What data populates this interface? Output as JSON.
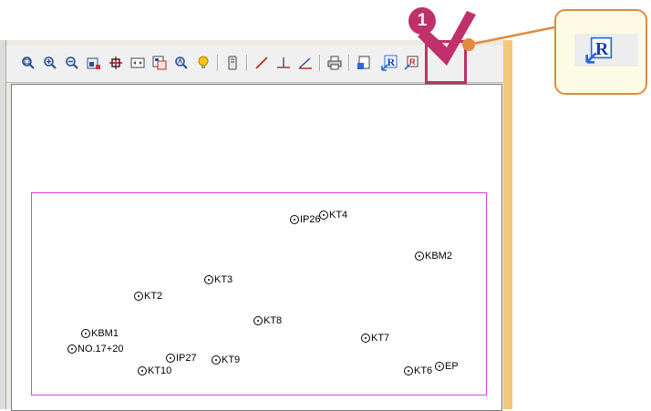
{
  "toolbar": {
    "buttons": [
      {
        "name": "zoom-window-icon"
      },
      {
        "name": "zoom-in-icon"
      },
      {
        "name": "zoom-out-icon"
      },
      {
        "name": "zoom-all-icon"
      },
      {
        "name": "pan-icon"
      },
      {
        "name": "fit-extents-icon"
      },
      {
        "name": "zoom-previous-icon"
      },
      {
        "name": "zoom-realtime-icon"
      },
      {
        "name": "bulb-icon"
      },
      {
        "name": "layer-icon"
      },
      {
        "name": "draw-line-icon"
      },
      {
        "name": "draw-perpendicular-icon"
      },
      {
        "name": "draw-angle-icon"
      },
      {
        "name": "print-icon"
      },
      {
        "name": "export-icon"
      },
      {
        "name": "register-r-icon"
      },
      {
        "name": "register-mark-icon"
      }
    ]
  },
  "annotation": {
    "step_number": "1",
    "accent_color": "#c0306a",
    "callout_border_color": "#e28a3e"
  },
  "points": [
    {
      "label": "IP26"
    },
    {
      "label": "KT4"
    },
    {
      "label": "KBM2"
    },
    {
      "label": "KT3"
    },
    {
      "label": "KT2"
    },
    {
      "label": "KT8"
    },
    {
      "label": "KBM1"
    },
    {
      "label": "KT7"
    },
    {
      "label": "NO.17+20"
    },
    {
      "label": "IP27"
    },
    {
      "label": "KT9"
    },
    {
      "label": "KT10"
    },
    {
      "label": "KT6"
    },
    {
      "label": "EP"
    }
  ],
  "colors": {
    "frame": "#e040e0",
    "window_accent": "#f2c97b"
  }
}
